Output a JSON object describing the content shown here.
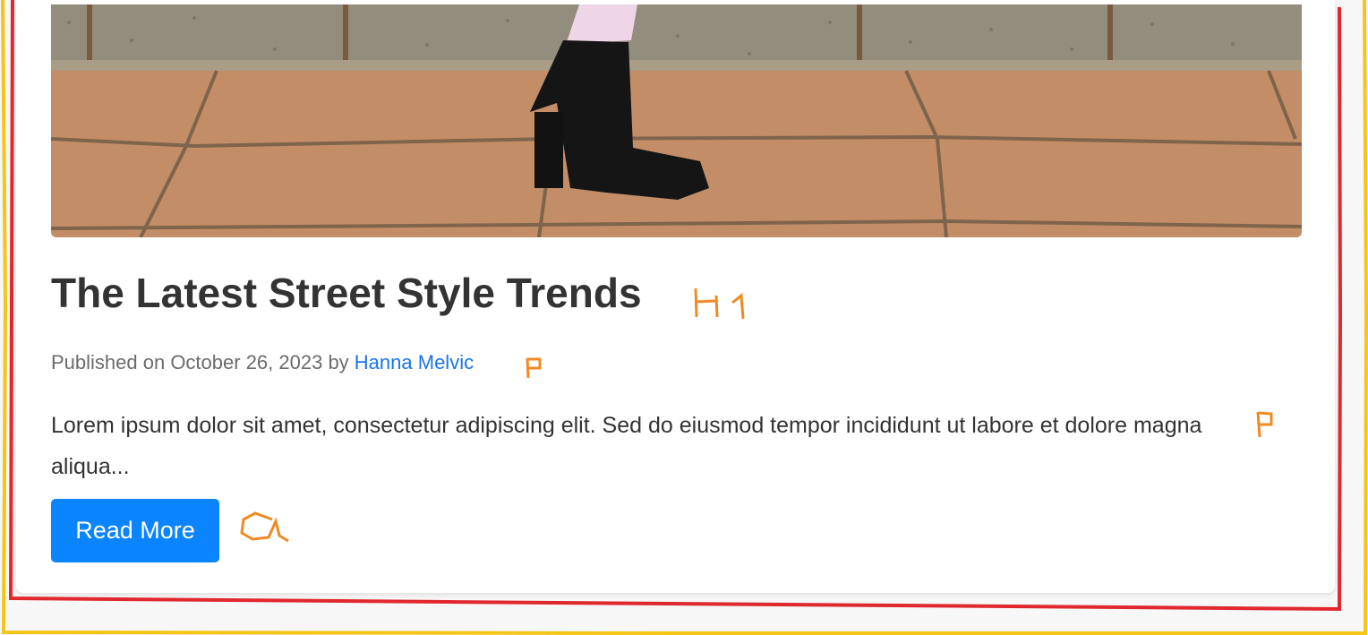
{
  "article": {
    "title": "The Latest Street Style Trends",
    "meta_prefix": "Published on October 26, 2023 by ",
    "author": "Hanna Melvic",
    "excerpt": "Lorem ipsum dolor sit amet, consectetur adipiscing elit. Sed do eiusmod tempor incididunt ut labore et dolore magna aliqua...",
    "read_more_label": "Read More"
  },
  "annotations": {
    "title_tag": "H 1",
    "meta_tag": "P",
    "excerpt_tag": "P",
    "button_tag": "a"
  },
  "colors": {
    "button": "#0a84ff",
    "author_link": "#1a75e8",
    "annotation_orange": "#f08a24",
    "outline_red": "#e0282e",
    "outline_yellow": "#f5c518"
  }
}
